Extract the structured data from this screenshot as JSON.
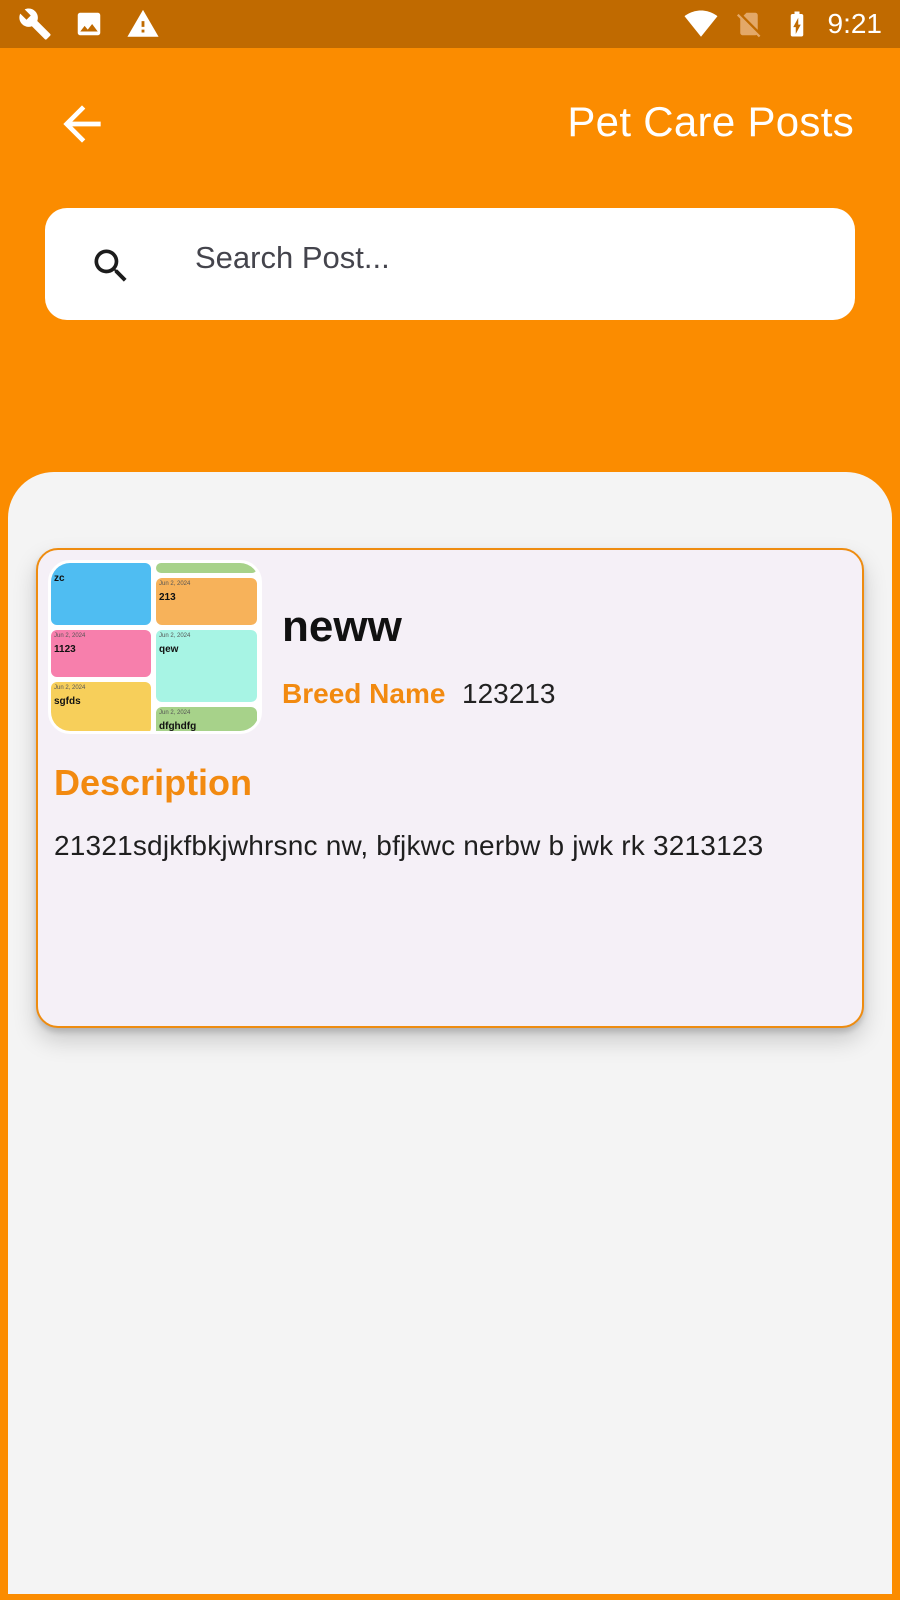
{
  "status_bar": {
    "time": "9:21",
    "left_icons": [
      "wrench-icon",
      "image-icon",
      "warning-icon"
    ],
    "right_icons": [
      "wifi-icon",
      "no-sim-icon",
      "battery-charging-icon"
    ]
  },
  "app_bar": {
    "title": "Pet Care Posts",
    "back_icon": "arrow-back-icon"
  },
  "search": {
    "placeholder": "Search Post..."
  },
  "posts": [
    {
      "title": "neww",
      "breed_label": "Breed Name",
      "breed_value": "123213",
      "description_heading": "Description",
      "description": "21321sdjkfbkjwhrsnc nw, bfjkwc nerbw b jwk rk 3213123",
      "thumbnail": {
        "tiles": [
          {
            "date": "",
            "title": "zc",
            "color": "#4fbdf2"
          },
          {
            "date": "",
            "title": "",
            "color": "#a7d28a"
          },
          {
            "date": "Jun 2, 2024",
            "title": "213",
            "color": "#f7b25a"
          },
          {
            "date": "Jun 2, 2024",
            "title": "1123",
            "color": "#f77fac"
          },
          {
            "date": "Jun 2, 2024",
            "title": "qew",
            "color": "#a7f4e4"
          },
          {
            "date": "Jun 2, 2024",
            "title": "sgfds",
            "color": "#f7cf5a"
          },
          {
            "date": "Jun 2, 2024",
            "title": "dfghdfg",
            "color": "#a7d28a"
          }
        ]
      }
    }
  ],
  "colors": {
    "primary": "#fb8c00",
    "status_bar": "#c06a00",
    "accent_text": "#f28a10",
    "sheet": "#f4f4f4",
    "card": "#f5f0f7"
  }
}
